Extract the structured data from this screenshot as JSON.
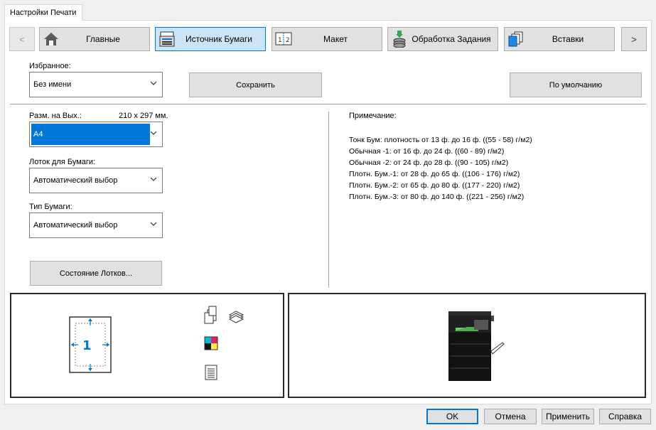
{
  "tab_title": "Настройки Печати",
  "nav": {
    "prev_glyph": "<",
    "next_glyph": ">",
    "tabs": [
      {
        "label": "Главные",
        "icon": "home-icon"
      },
      {
        "label": "Источник Бумаги",
        "icon": "paper-source-icon",
        "active": true
      },
      {
        "label": "Макет",
        "icon": "layout-icon"
      },
      {
        "label": "Обработка Задания",
        "icon": "job-handling-icon"
      },
      {
        "label": "Вставки",
        "icon": "inserts-icon"
      }
    ]
  },
  "favorites": {
    "label": "Избранное:",
    "value": "Без имени",
    "save_label": "Сохранить",
    "default_label": "По умолчанию"
  },
  "output_size": {
    "label": "Разм. на Вых.:",
    "dimensions": "210 x 297 мм.",
    "value": "A4"
  },
  "paper_tray": {
    "label": "Лоток для Бумаги:",
    "value": "Автоматический выбор"
  },
  "paper_type": {
    "label": "Тип Бумаги:",
    "value": "Автоматический выбор"
  },
  "tray_status_label": "Состояние Лотков...",
  "note": {
    "label": "Примечание:",
    "lines": [
      "Тонк Бум: плотность от 13 ф. до 16 ф. ((55 - 58) г/м2)",
      "Обычная -1: от 16 ф. до 24 ф. ((60 - 89) г/м2)",
      "Обычная -2: от 24 ф. до 28 ф. ((90 - 105) г/м2)",
      "Плотн. Бум.-1: от 28 ф. до 65 ф. ((106 - 176) г/м2)",
      "Плотн. Бум.-2: от 65 ф. до 80 ф. ((177 - 220) г/м2)",
      "Плотн. Бум.-3: от 80 ф. до 140 ф. ((221 - 256) г/м2)"
    ]
  },
  "preview": {
    "page_number": "1"
  },
  "dialog": {
    "ok": "OK",
    "cancel": "Отмена",
    "apply": "Применить",
    "help": "Справка"
  },
  "colors": {
    "accent": "#0078d7",
    "active_tab": "#cce4f7",
    "button": "#e1e1e1"
  }
}
